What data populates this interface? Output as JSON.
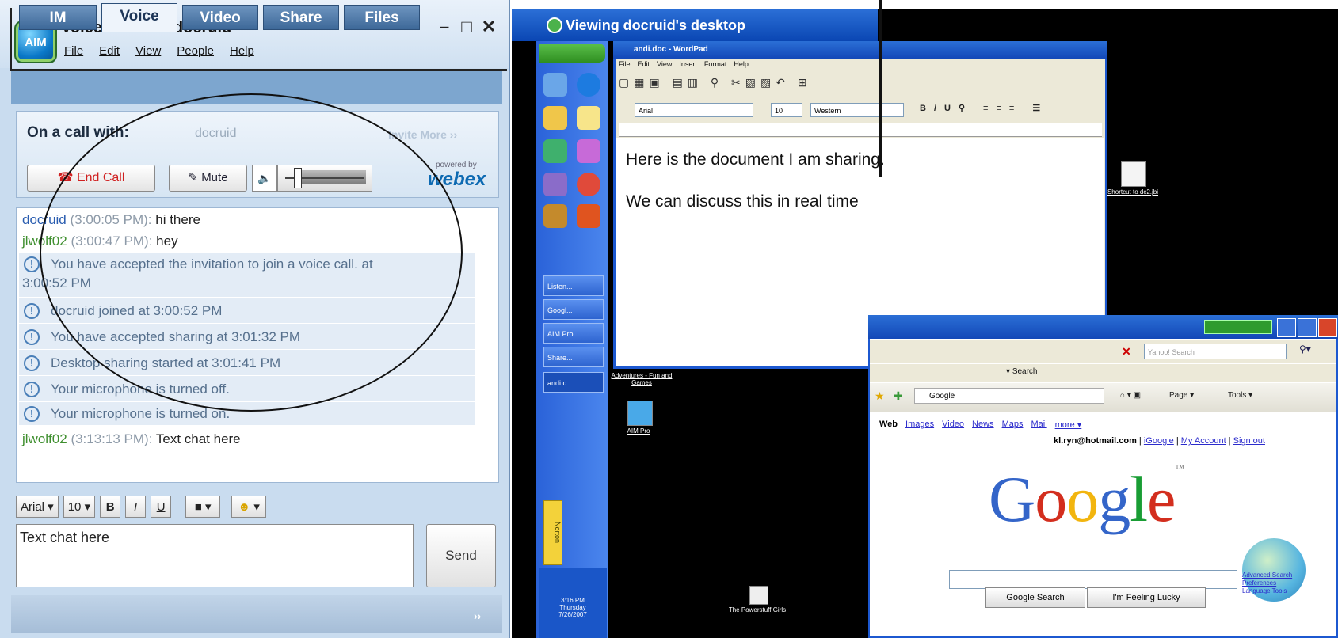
{
  "aim": {
    "title": "Voice call with docruid",
    "logo_text": "AIM",
    "window_buttons": [
      "–",
      "□",
      "✕"
    ],
    "menu": [
      "File",
      "Edit",
      "View",
      "People",
      "Help"
    ],
    "tabs": [
      "IM",
      "Voice",
      "Video",
      "Share",
      "Files"
    ],
    "active_tab": "Voice",
    "call": {
      "label": "On a call with:",
      "contact": "docruid",
      "invite_more": "Invite More ››",
      "end_call": "End Call",
      "mute": "Mute",
      "powered_by": "powered by",
      "brand": "webex",
      "volume_level": 0.15
    },
    "chat": [
      {
        "who": "docruid",
        "time": "(3:00:05 PM):",
        "text": "hi there",
        "kind": "user1"
      },
      {
        "who": "jlwolf02",
        "time": "(3:00:47 PM):",
        "text": "hey",
        "kind": "user2"
      },
      {
        "text": "You have accepted the invitation to join a voice call. at",
        "text2": "3:00:52 PM",
        "kind": "system"
      },
      {
        "text": "docruid joined at 3:00:52 PM",
        "kind": "system"
      },
      {
        "text": "You have accepted sharing at 3:01:32 PM",
        "kind": "system"
      },
      {
        "text": "Desktop sharing started at 3:01:41 PM",
        "kind": "system"
      },
      {
        "text": "Your microphone is turned off.",
        "kind": "system"
      },
      {
        "text": "Your microphone is turned on.",
        "kind": "system"
      },
      {
        "who": "jlwolf02",
        "time": "(3:13:13 PM):",
        "text": "Text chat here",
        "kind": "user2"
      }
    ],
    "format": {
      "font": "Arial",
      "size": "10",
      "bold": "B",
      "italic": "I",
      "underline": "U"
    },
    "input_value": "Text chat here",
    "send": "Send",
    "footer_more": "››"
  },
  "remote": {
    "title": "Viewing docruid's desktop",
    "taskbar_items": [
      "Listen...",
      "Googl...",
      "AIM Pro",
      "Share...",
      "andi.d..."
    ],
    "norton": "Norton",
    "clock": [
      "3:16 PM",
      "Thursday",
      "7/26/2007"
    ],
    "wordpad": {
      "title": "andi.doc - WordPad",
      "menu": [
        "File",
        "Edit",
        "View",
        "Insert",
        "Format",
        "Help"
      ],
      "font": "Arial",
      "size": "10",
      "script": "Western",
      "line1": "Here is the document I am sharing.",
      "line2": "We can discuss this in real time"
    },
    "desktop_icons": [
      {
        "label": "Shortcut to dc2.jbi"
      },
      {
        "label": "Adventures - Fun and Games"
      },
      {
        "label": "AIM Pro"
      },
      {
        "label": "The Powerstuff Girls"
      }
    ],
    "ie": {
      "search_placeholder": "Yahoo! Search",
      "search_label": "Search",
      "address": "Google",
      "menu_right": [
        "Page ▾",
        "Tools ▾"
      ],
      "links": [
        "Web",
        "Images",
        "Video",
        "News",
        "Maps",
        "Mail",
        "more ▾"
      ],
      "account_email": "kl.ryn@hotmail.com",
      "account_links": [
        "iGoogle",
        "My Account",
        "Sign out"
      ],
      "logo_letters": [
        {
          "ch": "G",
          "color": "#3465c9"
        },
        {
          "ch": "o",
          "color": "#d32e1e"
        },
        {
          "ch": "o",
          "color": "#f2b50f"
        },
        {
          "ch": "g",
          "color": "#3465c9"
        },
        {
          "ch": "l",
          "color": "#199d34"
        },
        {
          "ch": "e",
          "color": "#d32e1e"
        }
      ],
      "google_search": "Google Search",
      "lucky": "I'm Feeling Lucky",
      "advanced": [
        "Advanced Search",
        "Preferences",
        "Language Tools"
      ]
    }
  },
  "colors": {
    "aim_blue": "#7da6cf",
    "xp_blue": "#1c58d0",
    "end_call_red": "#d02020",
    "webex_blue": "#0d6ab2"
  }
}
